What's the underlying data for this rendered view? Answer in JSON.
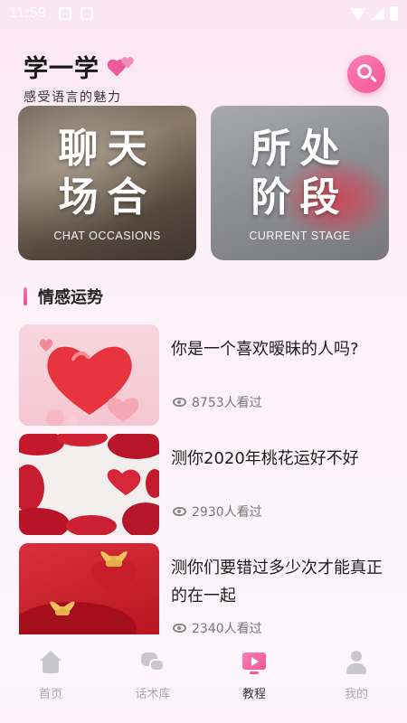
{
  "status_bar": {
    "time": "11:59"
  },
  "header": {
    "title": "学一学",
    "subtitle": "感受语言的魅力"
  },
  "banners": [
    {
      "title_line1": "聊天",
      "title_line2": "场合",
      "subtitle": "CHAT OCCASIONS"
    },
    {
      "title_line1": "所处",
      "title_line2": "阶段",
      "subtitle": "CURRENT STAGE"
    }
  ],
  "section": {
    "title": "情感运势"
  },
  "articles": [
    {
      "title": "你是一个喜欢暧昧的人吗?",
      "views": "8753人看过"
    },
    {
      "title": "测你2020年桃花运好不好",
      "views": "2930人看过"
    },
    {
      "title": "测你们要错过多少次才能真正的在一起",
      "views": "2340人看过"
    }
  ],
  "bottom_nav": [
    {
      "label": "首页",
      "icon": "home-icon"
    },
    {
      "label": "话术库",
      "icon": "chat-icon"
    },
    {
      "label": "教程",
      "icon": "tutorial-icon",
      "active": true
    },
    {
      "label": "我的",
      "icon": "profile-icon"
    }
  ],
  "colors": {
    "accent": "#f25896",
    "background": "#fbe6f3"
  }
}
